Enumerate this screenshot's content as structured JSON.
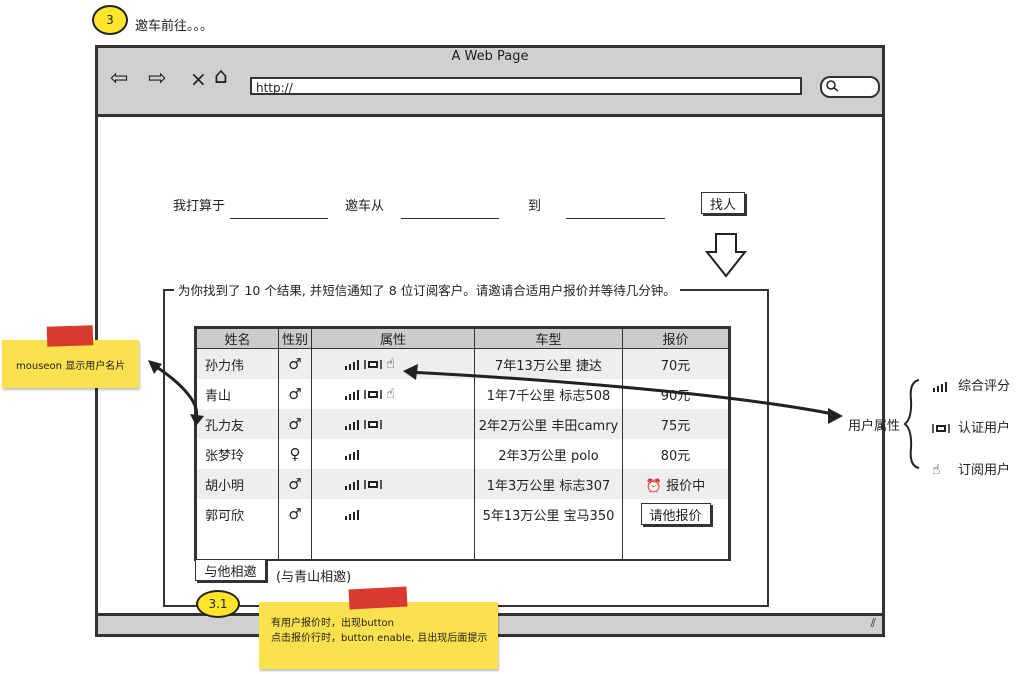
{
  "step": {
    "badge": "3",
    "caption": "邀车前往。。。"
  },
  "browser": {
    "title": "A Web Page",
    "url": "http://"
  },
  "form": {
    "label_plan": "我打算于",
    "label_from": "邀车从",
    "label_to": "到",
    "search_button": "找人"
  },
  "results": {
    "message": "为你找到了 10 个结果, 并短信通知了 8 位订阅客户。请邀请合适用户报价并等待几分钟。",
    "columns": [
      "姓名",
      "性别",
      "属性",
      "车型",
      "报价"
    ],
    "rows": [
      {
        "name": "孙力伟",
        "gender": "male",
        "attrs": [
          "rating-icon",
          "verified-icon",
          "subscribe-icon"
        ],
        "car": "7年13万公里 捷达",
        "quote": "70元"
      },
      {
        "name": "青山",
        "gender": "male",
        "attrs": [
          "rating-icon",
          "verified-icon",
          "subscribe-icon"
        ],
        "car": "1年7千公里 标志508",
        "quote": "90元"
      },
      {
        "name": "孔力友",
        "gender": "male",
        "attrs": [
          "rating-icon",
          "verified-icon"
        ],
        "car": "2年2万公里 丰田camry",
        "quote": "75元"
      },
      {
        "name": "张梦玲",
        "gender": "female",
        "attrs": [
          "rating-icon"
        ],
        "car": "2年3万公里 polo",
        "quote": "80元"
      },
      {
        "name": "胡小明",
        "gender": "male",
        "attrs": [
          "rating-icon",
          "verified-icon"
        ],
        "car": "1年3万公里 标志307",
        "quote": "报价中",
        "quote_status": "pending"
      },
      {
        "name": "郭可欣",
        "gender": "male",
        "attrs": [
          "rating-icon"
        ],
        "car": "5年13万公里 宝马350",
        "quote": "请他报价",
        "quote_status": "button"
      }
    ],
    "invite_button": "与他相邀",
    "invite_note": "(与青山相邀)"
  },
  "legend": {
    "title": "用户属性",
    "items": [
      {
        "icon": "rating-icon",
        "label": "综合评分"
      },
      {
        "icon": "verified-icon",
        "label": "认证用户"
      },
      {
        "icon": "subscribe-icon",
        "label": "订阅用户"
      }
    ]
  },
  "notes": {
    "left": "mouseon 显示用户名片",
    "bottom_badge": "3.1",
    "bottom_line1": "有用户报价时，出现button",
    "bottom_line2": "点击报价行时，button enable, 且出现后面提示"
  },
  "colors": {
    "sticky": "#fbe14e",
    "tape": "#d93a2f",
    "chrome": "#d0d0d0",
    "badge": "#ffe52b"
  }
}
